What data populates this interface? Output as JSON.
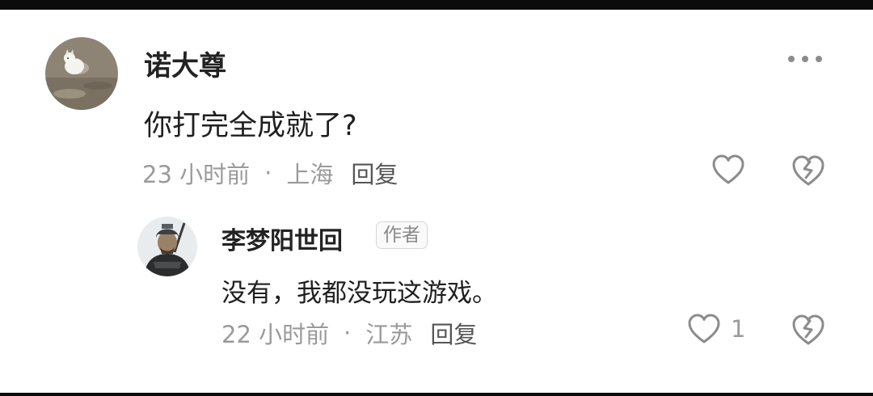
{
  "comment": {
    "username": "诺大尊",
    "avatar": "cat-photo-avatar",
    "text": "你打完全成就了?",
    "time": "23 小时前",
    "separator": "·",
    "location": "上海",
    "reply_label": "回复",
    "more_icon": "more-dots-icon",
    "like_icon": "heart-outline-icon",
    "dislike_icon": "broken-heart-icon"
  },
  "reply": {
    "username": "李梦阳世回",
    "badge": "作者",
    "avatar": "armored-warrior-avatar",
    "text": "没有，我都没玩这游戏。",
    "time": "22 小时前",
    "separator": "·",
    "location": "江苏",
    "reply_label": "回复",
    "like_count": "1",
    "like_icon": "heart-outline-icon",
    "dislike_icon": "broken-heart-icon"
  },
  "colors": {
    "username": "#222222",
    "body_text": "#1f1f1f",
    "meta_text": "#9a9a9a",
    "icon_gray": "#8c8c8c",
    "frame_bar": "#0c0c0c"
  }
}
